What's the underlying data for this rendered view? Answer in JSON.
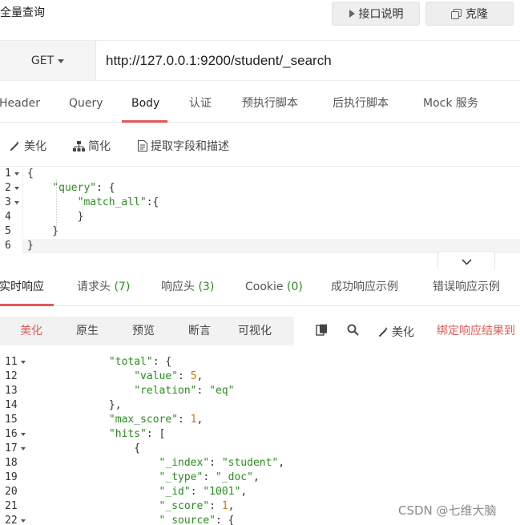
{
  "title": "全量查询",
  "buttons": {
    "doc": "接口说明",
    "clone": "克隆"
  },
  "request": {
    "method": "GET",
    "url": "http://127.0.0.1:9200/student/_search"
  },
  "tabs": [
    {
      "label": "Header",
      "active": false
    },
    {
      "label": "Query",
      "active": false
    },
    {
      "label": "Body",
      "active": true
    },
    {
      "label": "认证",
      "active": false
    },
    {
      "label": "预执行脚本",
      "active": false
    },
    {
      "label": "后执行脚本",
      "active": false
    },
    {
      "label": "Mock 服务",
      "active": false
    }
  ],
  "body_toolbar": {
    "beautify": "美化",
    "simplify": "简化",
    "extract": "提取字段和描述"
  },
  "editor_lines": [
    {
      "n": "1",
      "fold": true,
      "text": "{"
    },
    {
      "n": "2",
      "fold": true,
      "text": "    \"query\": {"
    },
    {
      "n": "3",
      "fold": true,
      "text": "        \"match_all\":{"
    },
    {
      "n": "4",
      "fold": false,
      "text": "        }"
    },
    {
      "n": "5",
      "fold": false,
      "text": "    }"
    },
    {
      "n": "6",
      "fold": false,
      "text": "}"
    }
  ],
  "response_tabs": {
    "realtime": "实时响应",
    "req_headers": "请求头",
    "req_headers_count": "(7)",
    "resp_headers": "响应头",
    "resp_headers_count": "(3)",
    "cookie": "Cookie",
    "cookie_count": "(0)",
    "success_example": "成功响应示例",
    "error_example": "错误响应示例"
  },
  "view_tabs": {
    "beautify": "美化",
    "raw": "原生",
    "preview": "预览",
    "assert": "断言",
    "visualize": "可视化"
  },
  "view_tools": {
    "beautify": "美化",
    "bind": "绑定响应结果到"
  },
  "response_lines": [
    {
      "n": "11",
      "fold": true,
      "text": "            \"total\": {"
    },
    {
      "n": "12",
      "fold": false,
      "text": "                \"value\": 5,"
    },
    {
      "n": "13",
      "fold": false,
      "text": "                \"relation\": \"eq\""
    },
    {
      "n": "14",
      "fold": false,
      "text": "            },"
    },
    {
      "n": "15",
      "fold": false,
      "text": "            \"max_score\": 1,"
    },
    {
      "n": "16",
      "fold": true,
      "text": "            \"hits\": ["
    },
    {
      "n": "17",
      "fold": true,
      "text": "                {"
    },
    {
      "n": "18",
      "fold": false,
      "text": "                    \"_index\": \"student\","
    },
    {
      "n": "19",
      "fold": false,
      "text": "                    \"_type\": \"_doc\","
    },
    {
      "n": "20",
      "fold": false,
      "text": "                    \"_id\": \"1001\","
    },
    {
      "n": "21",
      "fold": false,
      "text": "                    \"_score\": 1,"
    },
    {
      "n": "22",
      "fold": true,
      "text": "                    \"_source\": {"
    }
  ],
  "watermark": "CSDN @七维大脑",
  "colors": {
    "accent": "#e25a54",
    "json_key": "#2a8d1e",
    "json_number": "#d1750b"
  },
  "icons": [
    "play-icon",
    "copy-icon",
    "caret-down-icon",
    "magic-wand-icon",
    "sitemap-icon",
    "document-icon",
    "chevron-down-icon",
    "clipboard-icon",
    "search-icon"
  ]
}
